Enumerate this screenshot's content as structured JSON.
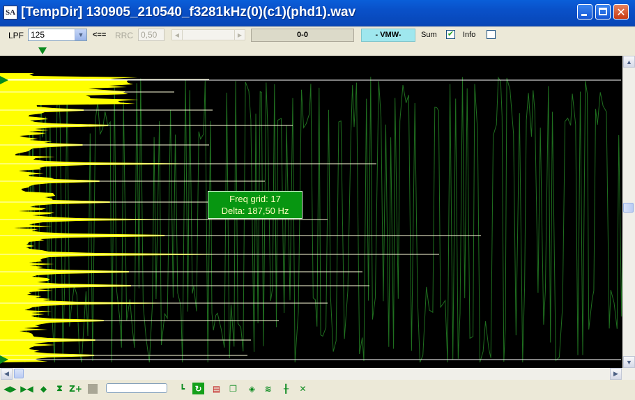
{
  "window": {
    "app_icon": "SA",
    "title": "[TempDir] 130905_210540_f3281kHz(0)(c1)(phd1).wav"
  },
  "toolbar": {
    "lpf_label": "LPF",
    "lpf_value": "125",
    "arrow_label": "<==",
    "rrc_label": "RRC",
    "rrc_value": "0,50",
    "status_text": "0-0",
    "mode_text": "- VMW-",
    "sum_label": "Sum",
    "sum_checked": true,
    "info_label": "Info",
    "info_checked": false
  },
  "tooltip": {
    "line1": "Freq grid: 17",
    "line2": "Delta: 187,50 Hz"
  },
  "colors": {
    "spectrum": "#ffff00",
    "waveform": "#1f6f1f",
    "grid_lines": "#ffffff",
    "tooltip_bg": "#079611"
  },
  "bottom_toolbar": {
    "icons": [
      "expand-horizontal-icon",
      "shrink-horizontal-icon",
      "expand-vertical-icon",
      "shrink-vertical-icon",
      "zoom-plus-icon",
      "stop-icon",
      "baseline-icon",
      "refresh-icon",
      "clipboard-icon",
      "copy-icon",
      "marker-icon",
      "waveform-icon",
      "grid-icon",
      "cross-icon"
    ],
    "zoom_label": "Z+"
  }
}
